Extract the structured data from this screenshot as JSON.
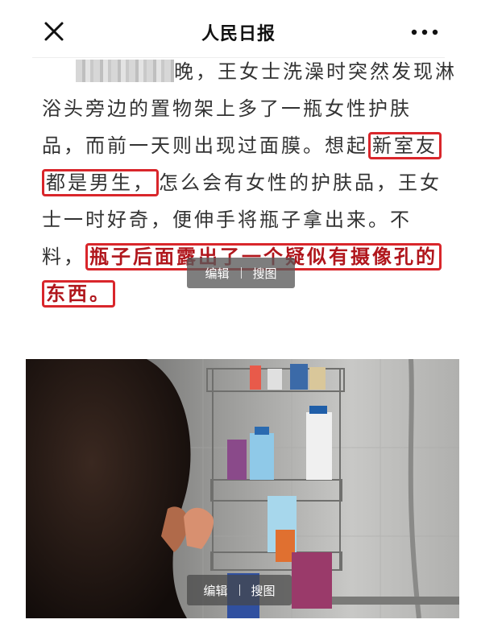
{
  "header": {
    "title": "人民日报",
    "close_icon": "close-icon",
    "more_icon": "more-dots-icon"
  },
  "article": {
    "line1": "晚，王女士洗澡时突然发现淋",
    "line2": "浴头旁边的置物架上多了一瓶女性护肤",
    "line3a": "品，而前一天则出现过面膜。想起",
    "line3b": "新室友",
    "line4a": "都是男生，",
    "line4b": "怎么会有女性的护肤品，王女",
    "line5": "士一时好奇，便伸手将瓶子拿出来。不",
    "line6a": "料，",
    "line6b": "瓶子后面露出了一个疑似有摄像孔的",
    "line7": "东西。"
  },
  "image_toolbar_top": {
    "edit_label": "编辑",
    "search_label": "搜图"
  },
  "image_toolbar_bottom": {
    "edit_label": "编辑",
    "search_label": "搜图"
  },
  "colors": {
    "highlight_box": "#d9262b",
    "highlight_text": "#b0161c"
  }
}
